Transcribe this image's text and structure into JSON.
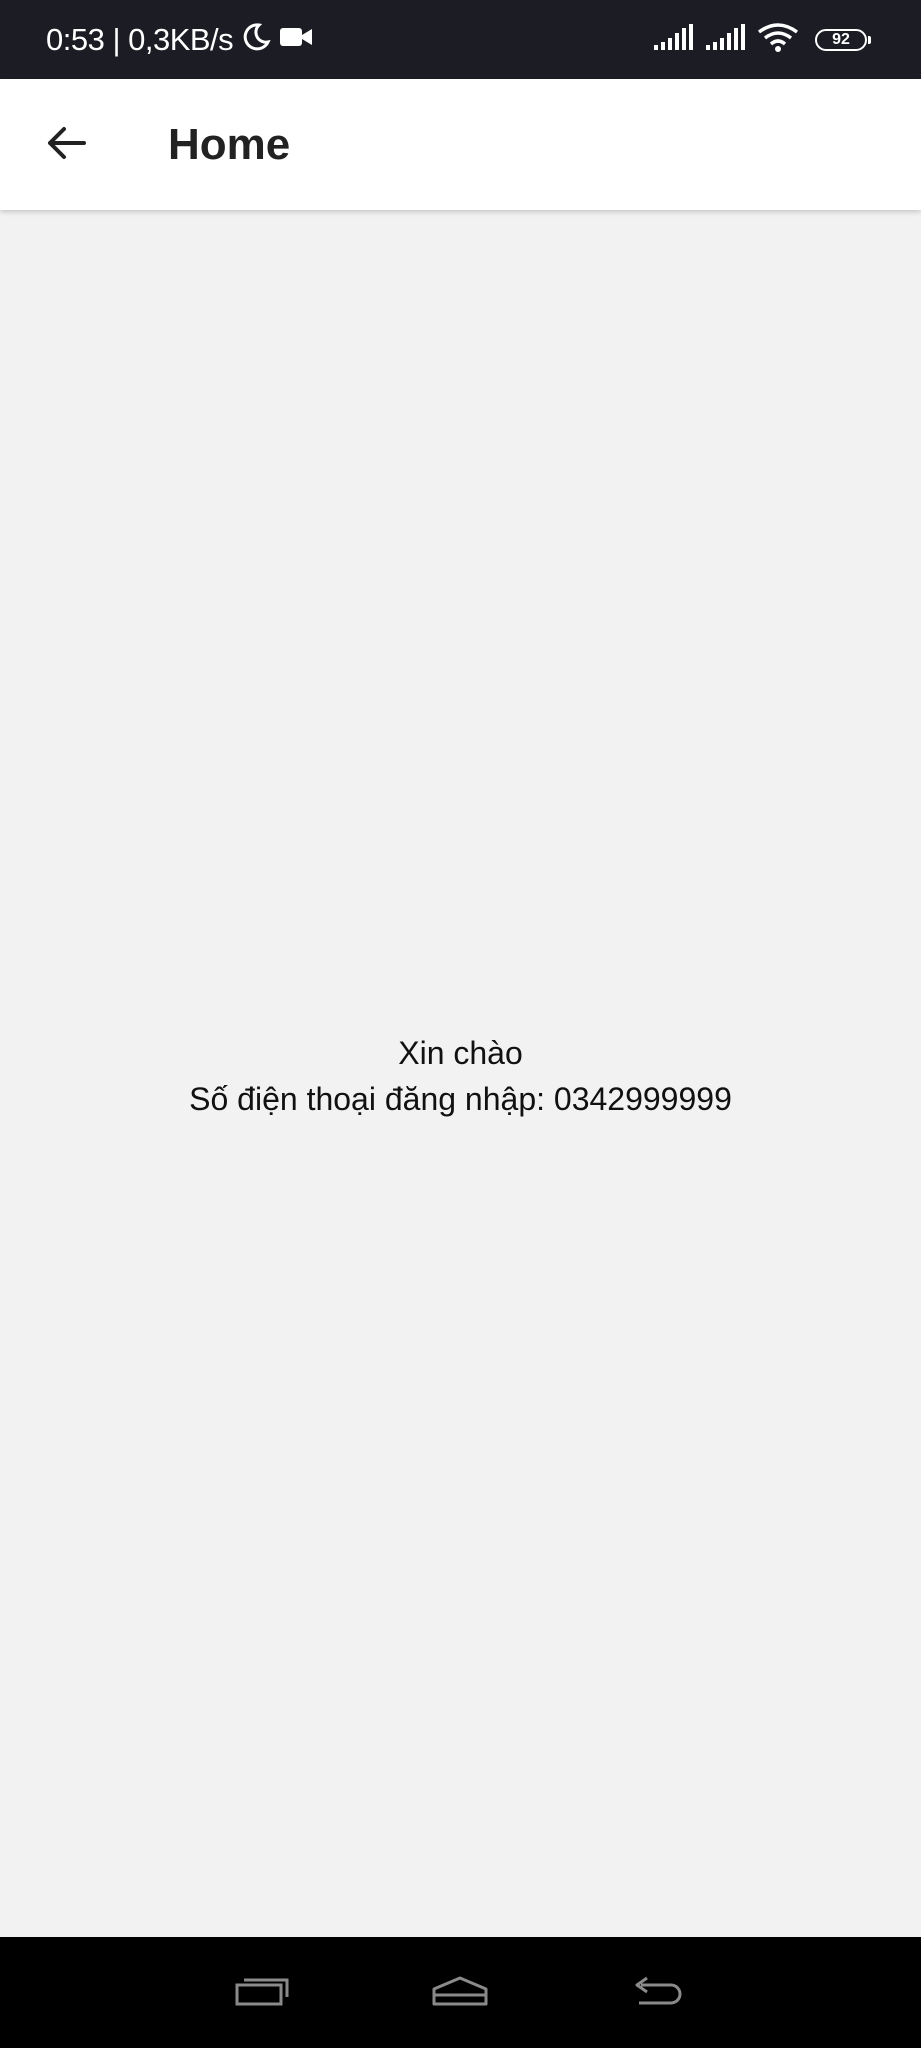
{
  "status_bar": {
    "time_and_speed": "0:53 | 0,3KB/s",
    "battery_level": "92",
    "icons": [
      "moon-icon",
      "video-camera-icon",
      "signal-icon",
      "signal-icon",
      "wifi-icon",
      "battery-icon"
    ]
  },
  "app_bar": {
    "title": "Home",
    "back_icon": "arrow-left-icon"
  },
  "content": {
    "greeting": "Xin chào",
    "phone_line": "Số điện thoại đăng nhập: 0342999999"
  },
  "nav_bar": {
    "icons": [
      "recent-apps-icon",
      "home-icon",
      "back-icon"
    ]
  },
  "colors": {
    "status_bar_bg": "#1b1c24",
    "app_bar_bg": "#ffffff",
    "page_bg": "#f2f2f2",
    "nav_bar_bg": "#000000",
    "text": "#111111"
  }
}
